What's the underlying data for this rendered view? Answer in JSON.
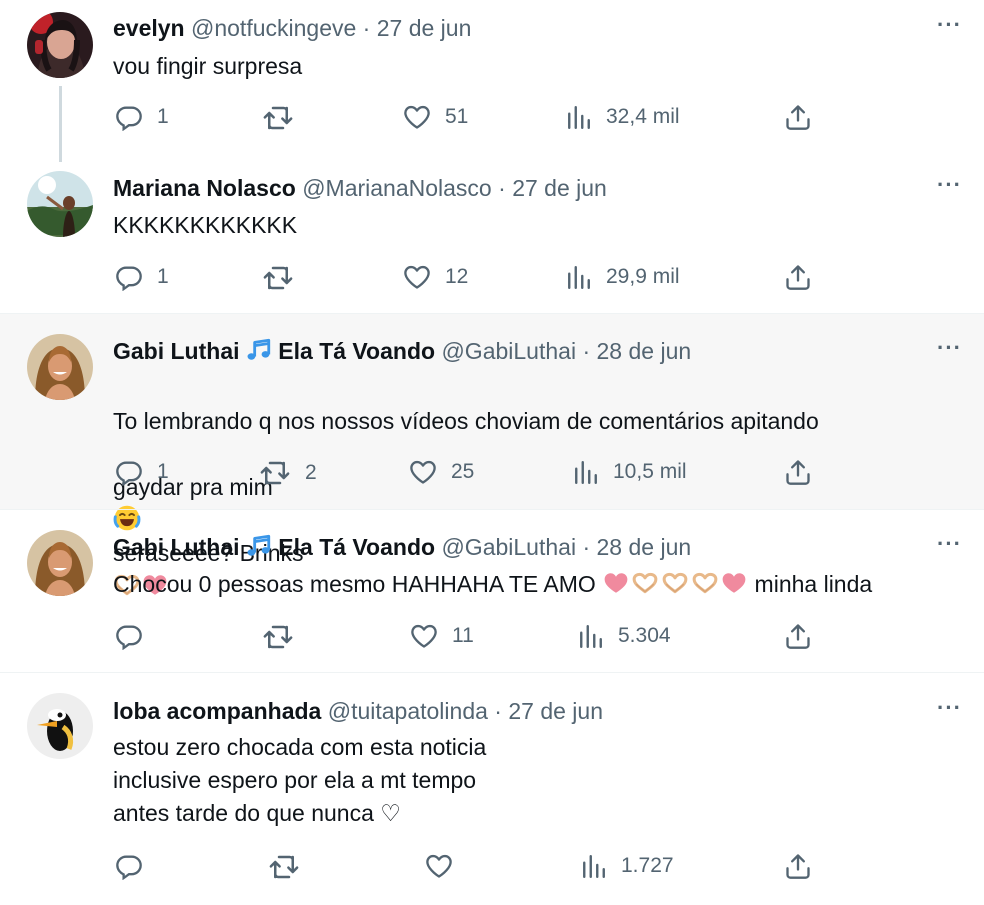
{
  "tweets": [
    {
      "name": "evelyn",
      "handle": "@notfuckingeve",
      "separator": "·",
      "date": "27 de jun",
      "text": "vou fingir surpresa",
      "replies": "1",
      "retweets": "",
      "likes": "51",
      "views": "32,4 mil"
    },
    {
      "name": "Mariana Nolasco",
      "handle": "@MarianaNolasco",
      "separator": "·",
      "date": "27 de jun",
      "text": "KKKKKKKKKKKK",
      "replies": "1",
      "retweets": "",
      "likes": "12",
      "views": "29,9 mil"
    },
    {
      "name": "Gabi Luthai",
      "name_suffix": "Ela Tá Voando",
      "handle": "@GabiLuthai",
      "separator": "·",
      "date": "28 de jun",
      "text_line1": "To lembrando q nos nossos vídeos choviam de comentários apitando",
      "text_line2a": "gaydar pra mim",
      "text_line2b": "seraseeee? Brinks",
      "replies": "1",
      "retweets": "2",
      "likes": "25",
      "views": "10,5 mil"
    },
    {
      "name": "Gabi Luthai",
      "name_suffix": "Ela Tá Voando",
      "handle": "@GabiLuthai",
      "separator": "·",
      "date": "28 de jun",
      "text_a": "Chocou 0 pessoas mesmo HAHHAHA TE AMO",
      "text_b": "minha linda",
      "replies": "",
      "retweets": "",
      "likes": "11",
      "views": "5.304"
    },
    {
      "name": "loba acompanhada",
      "handle": "@tuitapatolinda",
      "separator": "·",
      "date": "27 de jun",
      "text": "estou zero chocada com esta noticia\ninclusive espero por ela a mt tempo\nantes tarde do que nunca ♡",
      "replies": "",
      "retweets": "",
      "likes": "",
      "views": "1.727"
    }
  ],
  "more_label": "···",
  "icons": [
    "reply-icon",
    "retweet-icon",
    "like-icon",
    "views-icon",
    "share-icon",
    "more-icon",
    "music-note-icon",
    "laugh-cry-emoji",
    "heart-hands-emoji",
    "pink-heart-emoji"
  ],
  "colors": {
    "accent": "#1d9bf0",
    "muted": "#536471",
    "text": "#0f1419",
    "highlight_bg": "#f7f7f7",
    "pink_heart": "#f08a9e"
  }
}
